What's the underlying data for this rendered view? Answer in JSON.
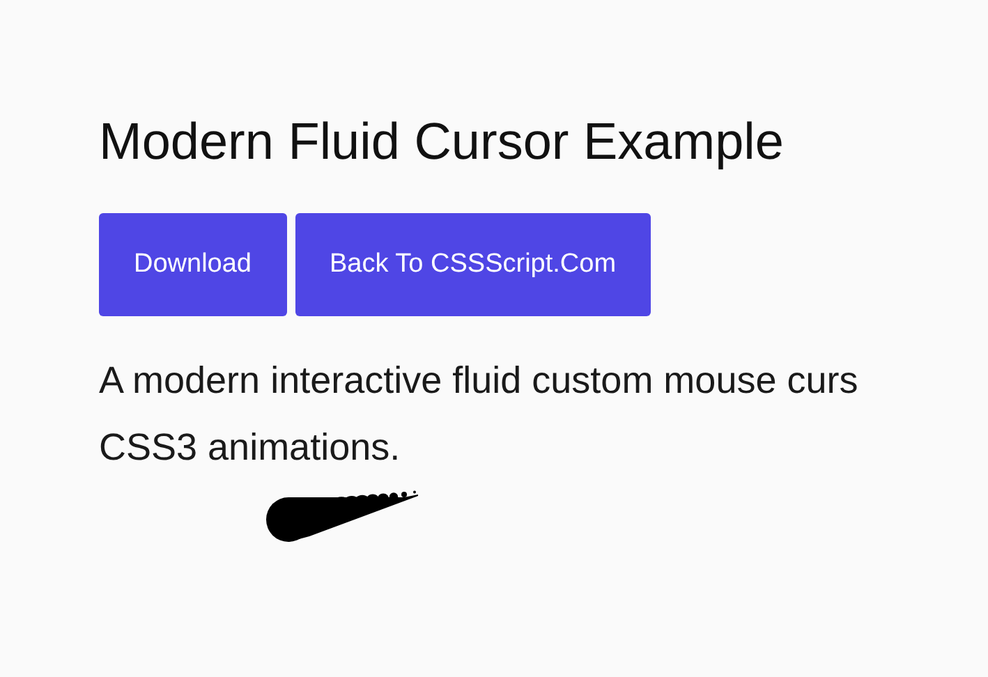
{
  "title": "Modern Fluid Cursor Example",
  "buttons": [
    {
      "label": "Download"
    },
    {
      "label": "Back To CSSScript.Com"
    }
  ],
  "description_lines": [
    "A modern interactive fluid custom mouse curs",
    "CSS3 animations."
  ]
}
